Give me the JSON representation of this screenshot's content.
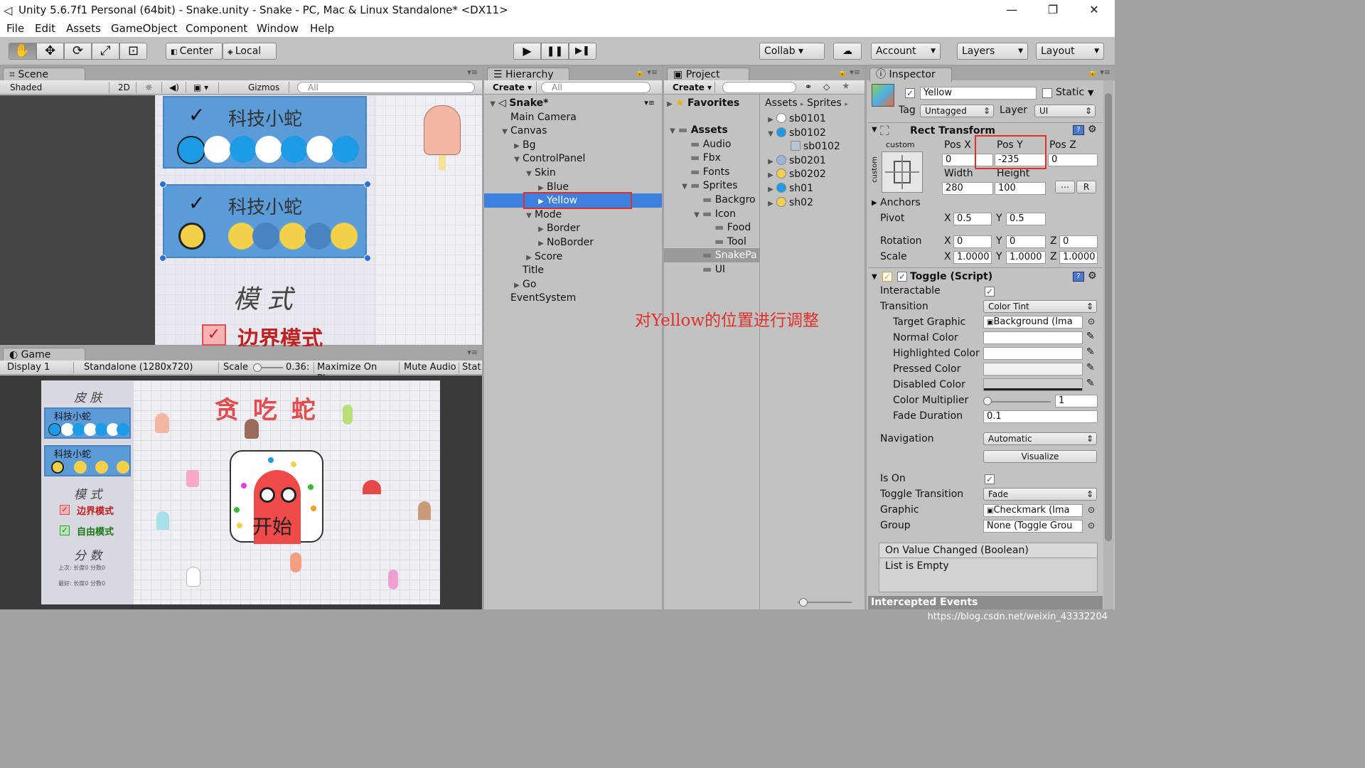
{
  "window": {
    "title": "Unity 5.6.7f1 Personal (64bit) - Snake.unity - Snake - PC, Mac & Linux Standalone* <DX11>",
    "controls": {
      "minimize": "—",
      "restore": "❐",
      "close": "✕"
    }
  },
  "menu": [
    "File",
    "Edit",
    "Assets",
    "GameObject",
    "Component",
    "Window",
    "Help"
  ],
  "toolbar": {
    "tools": [
      "✋",
      "✥",
      "⟳",
      "⤢",
      "⊡"
    ],
    "pivot": "Center",
    "space": "Local",
    "play": "▶",
    "pause": "❚❚",
    "step": "▶❚",
    "collab": "Collab ▾",
    "cloud": "☁",
    "account": "Account",
    "layers": "Layers",
    "layout": "Layout"
  },
  "scene": {
    "tab": "Scene",
    "shading": "Shaded",
    "mode2d": "2D",
    "gizmos": "Gizmos",
    "search_placeholder": "All",
    "card_title": "科技小蛇",
    "mode_title": "模 式",
    "border_mode": "边界模式",
    "check": "✓"
  },
  "game": {
    "tab": "Game",
    "display": "Display 1",
    "resolution": "Standalone (1280x720)",
    "scale_label": "Scale",
    "scale_value": "0.36:",
    "maximize": "Maximize On Play",
    "mute": "Mute Audio",
    "stats": "Stat",
    "skin_title": "皮 肤",
    "card_title": "科技小蛇",
    "mode_title": "模 式",
    "border_mode": "边界模式",
    "free_mode": "自由模式",
    "score_title": "分 数",
    "score_line1": "上次: 长度0  分数0",
    "score_line2": "最好: 长度0  分数0",
    "game_title": "贪 吃 蛇",
    "start": "开始"
  },
  "hierarchy": {
    "tab": "Hierarchy",
    "create": "Create",
    "search_placeholder": "All",
    "items": [
      {
        "label": "Snake*",
        "depth": 0,
        "arrow": "▼",
        "bold": true
      },
      {
        "label": "Main Camera",
        "depth": 1,
        "arrow": ""
      },
      {
        "label": "Canvas",
        "depth": 1,
        "arrow": "▼"
      },
      {
        "label": "Bg",
        "depth": 2,
        "arrow": "▶"
      },
      {
        "label": "ControlPanel",
        "depth": 2,
        "arrow": "▼"
      },
      {
        "label": "Skin",
        "depth": 3,
        "arrow": "▼"
      },
      {
        "label": "Blue",
        "depth": 4,
        "arrow": "▶"
      },
      {
        "label": "Yellow",
        "depth": 4,
        "arrow": "▶",
        "selected": true
      },
      {
        "label": "Mode",
        "depth": 3,
        "arrow": "▼"
      },
      {
        "label": "Border",
        "depth": 4,
        "arrow": "▶"
      },
      {
        "label": "NoBorder",
        "depth": 4,
        "arrow": "▶"
      },
      {
        "label": "Score",
        "depth": 3,
        "arrow": "▶"
      },
      {
        "label": "Title",
        "depth": 2,
        "arrow": ""
      },
      {
        "label": "Go",
        "depth": 2,
        "arrow": "▶"
      },
      {
        "label": "EventSystem",
        "depth": 1,
        "arrow": ""
      }
    ]
  },
  "project": {
    "tab": "Project",
    "create": "Create",
    "favorites": "Favorites",
    "tree": [
      {
        "label": "Assets",
        "depth": 0,
        "arrow": "▼",
        "bold": true
      },
      {
        "label": "Audio",
        "depth": 1,
        "arrow": ""
      },
      {
        "label": "Fbx",
        "depth": 1,
        "arrow": ""
      },
      {
        "label": "Fonts",
        "depth": 1,
        "arrow": ""
      },
      {
        "label": "Sprites",
        "depth": 1,
        "arrow": "▼"
      },
      {
        "label": "Backgro",
        "depth": 2,
        "arrow": ""
      },
      {
        "label": "Icon",
        "depth": 2,
        "arrow": "▼"
      },
      {
        "label": "Food",
        "depth": 3,
        "arrow": ""
      },
      {
        "label": "Tool",
        "depth": 3,
        "arrow": ""
      },
      {
        "label": "SnakePa",
        "depth": 2,
        "arrow": "",
        "selected": true
      },
      {
        "label": "UI",
        "depth": 2,
        "arrow": ""
      }
    ],
    "breadcrumb": [
      "Assets",
      "Sprites"
    ],
    "files": [
      {
        "label": "sb0101",
        "arrow": "▶",
        "color": "#ffffff"
      },
      {
        "label": "sb0102",
        "arrow": "▼",
        "color": "#1d9be6"
      },
      {
        "label": "sb0102",
        "arrow": "",
        "color": "#b8c4d8",
        "child": true
      },
      {
        "label": "sb0201",
        "arrow": "▶",
        "color": "#9ab4dc"
      },
      {
        "label": "sb0202",
        "arrow": "▶",
        "color": "#f3d04a"
      },
      {
        "label": "sh01",
        "arrow": "▶",
        "color": "#1d9be6"
      },
      {
        "label": "sh02",
        "arrow": "▶",
        "color": "#f3d04a"
      }
    ]
  },
  "annotation": "对Yellow的位置进行调整",
  "inspector": {
    "tab": "Inspector",
    "object_name": "Yellow",
    "static": "Static",
    "tag_label": "Tag",
    "tag": "Untagged",
    "layer_label": "Layer",
    "layer": "UI",
    "rect_transform": "Rect Transform",
    "anchor_preset": "custom",
    "anchor_side": "custom",
    "pos_x_label": "Pos X",
    "pos_x": "0",
    "pos_y_label": "Pos Y",
    "pos_y": "-235",
    "pos_z_label": "Pos Z",
    "pos_z": "0",
    "width_label": "Width",
    "width": "280",
    "height_label": "Height",
    "height": "100",
    "r_button": "R",
    "anchors": "Anchors",
    "pivot": "Pivot",
    "pivot_x": "0.5",
    "pivot_y": "0.5",
    "rotation": "Rotation",
    "rot_x": "0",
    "rot_y": "0",
    "rot_z": "0",
    "scale": "Scale",
    "scale_x": "1.0000",
    "scale_y": "1.0000",
    "scale_z": "1.0000",
    "toggle_script": "Toggle (Script)",
    "interactable": "Interactable",
    "transition": "Transition",
    "transition_value": "Color Tint",
    "target_graphic": "Target Graphic",
    "target_graphic_value": "Background (Ima",
    "normal_color": "Normal Color",
    "highlighted_color": "Highlighted Color",
    "pressed_color": "Pressed Color",
    "disabled_color": "Disabled Color",
    "color_multiplier": "Color Multiplier",
    "color_multiplier_value": "1",
    "fade_duration": "Fade Duration",
    "fade_duration_value": "0.1",
    "navigation": "Navigation",
    "navigation_value": "Automatic",
    "visualize": "Visualize",
    "is_on": "Is On",
    "toggle_transition": "Toggle Transition",
    "toggle_transition_value": "Fade",
    "graphic": "Graphic",
    "graphic_value": "Checkmark (Ima",
    "group": "Group",
    "group_value": "None (Toggle Grou",
    "on_value_changed": "On Value Changed (Boolean)",
    "list_empty": "List is Empty",
    "intercepted": "Intercepted Events"
  },
  "watermark": "https://blog.csdn.net/weixin_43332204",
  "colors": {
    "selection": "#3d80df",
    "highlight_box": "#e0302a",
    "annotation": "#e0302a",
    "blue": "#1d9be6",
    "yellow": "#f3d04a"
  }
}
